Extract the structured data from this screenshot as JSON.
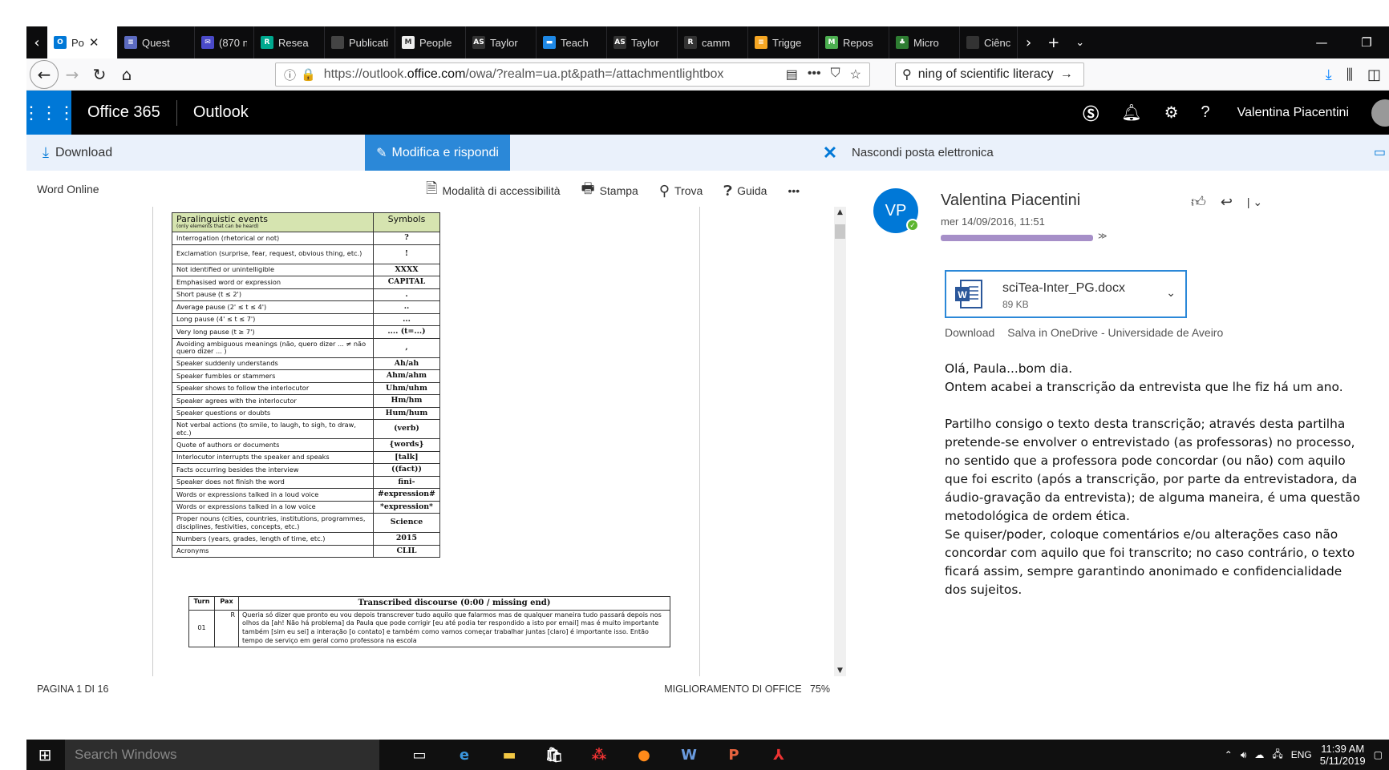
{
  "tabs": [
    {
      "label": "Po",
      "icon": "outlook-icon",
      "color": "#0078d7",
      "fav": "O"
    },
    {
      "label": "Quest",
      "icon": "forms-icon",
      "color": "#5c6bc0",
      "fav": "≡"
    },
    {
      "label": "(870 n",
      "icon": "mail-icon",
      "color": "#4a4ac8",
      "fav": "✉"
    },
    {
      "label": "Resea",
      "icon": "researchgate-icon",
      "color": "#00a98f",
      "fav": "R"
    },
    {
      "label": "Publicatio",
      "icon": "publications-icon",
      "color": "#444",
      "fav": ""
    },
    {
      "label": "People",
      "icon": "people-icon",
      "color": "#eeeeee",
      "fav": "M"
    },
    {
      "label": "Taylor",
      "icon": "taylor-icon",
      "color": "#333",
      "fav": "AS"
    },
    {
      "label": "Teach",
      "icon": "teach-icon",
      "color": "#1e88e5",
      "fav": "▬"
    },
    {
      "label": "Taylor",
      "icon": "taylor-icon",
      "color": "#333",
      "fav": "AS"
    },
    {
      "label": "camm",
      "icon": "r-icon",
      "color": "#333",
      "fav": "R"
    },
    {
      "label": "Trigge",
      "icon": "trigger-icon",
      "color": "#f5a623",
      "fav": "≡"
    },
    {
      "label": "Repos",
      "icon": "repos-icon",
      "color": "#4caf50",
      "fav": "M"
    },
    {
      "label": "Micro",
      "icon": "micro-icon",
      "color": "#2e7d32",
      "fav": "♣"
    },
    {
      "label": "Ciênc",
      "icon": "ciencia-icon",
      "color": "#333",
      "fav": ""
    }
  ],
  "url": {
    "prefix": "https://outlook.",
    "domain": "office.com",
    "path": "/owa/?realm=ua.pt&path=/attachmentlightbox"
  },
  "search": {
    "value": "ning of scientific literacy"
  },
  "office": {
    "brand": "Office 365",
    "app": "Outlook",
    "user": "Valentina Piacentini"
  },
  "toolbar": {
    "download": "Download",
    "edit": "Modifica e rispondi",
    "hide_mail": "Nascondi posta elettronica"
  },
  "wordbar": {
    "title": "Word Online",
    "accessibility": "Modalità di accessibilità",
    "print": "Stampa",
    "find": "Trova",
    "help": "Guida",
    "more": "•••"
  },
  "doc": {
    "para_header": "Paralinguistic events",
    "para_sub": "(only elements that can be heard)",
    "symbols_header": "Symbols",
    "rows": [
      [
        "Interrogation (rhetorical or not)",
        "?"
      ],
      [
        "Exclamation (surprise, fear, request, obvious thing, etc.)",
        "!"
      ],
      [
        "Not identified or unintelligible",
        "XXXX"
      ],
      [
        "Emphasised word or expression",
        "CAPITAL"
      ],
      [
        "Short pause (t ≤ 2')",
        "."
      ],
      [
        "Average pause (2' ≤ t ≤ 4')",
        ".."
      ],
      [
        "Long pause (4' ≤ t ≤ 7')",
        "..."
      ],
      [
        "Very long pause (t ≥ 7')",
        ".... (t=...)"
      ],
      [
        "Avoiding ambiguous meanings (não, quero dizer ... ≠ não quero dizer ... )",
        ","
      ],
      [
        "Speaker suddenly understands",
        "Ah/ah"
      ],
      [
        "Speaker fumbles or stammers",
        "Ahm/ahm"
      ],
      [
        "Speaker shows to follow the interlocutor",
        "Uhm/uhm"
      ],
      [
        "Speaker agrees with the interlocutor",
        "Hm/hm"
      ],
      [
        "Speaker questions or doubts",
        "Hum/hum"
      ],
      [
        "Not verbal actions (to smile, to laugh, to sigh, to draw, etc.)",
        "(verb)"
      ],
      [
        "Quote of authors or documents",
        "{words}"
      ],
      [
        "Interlocutor interrupts the speaker and speaks",
        "[talk]"
      ],
      [
        "Facts occurring besides the interview",
        "((fact))"
      ],
      [
        "Speaker does not finish the word",
        "fini-"
      ],
      [
        "Words or expressions talked in a loud voice",
        "#expression#"
      ],
      [
        "Words or expressions talked in a low voice",
        "*expression*"
      ],
      [
        "Proper nouns (cities, countries, institutions, programmes, disciplines, festivities, concepts, etc.)",
        "Science"
      ],
      [
        "Numbers (years, grades, length of time, etc.)",
        "2015"
      ],
      [
        "Acronyms",
        "CLIL"
      ]
    ],
    "disc_turn": "Turn",
    "disc_pax": "Pax",
    "disc_title": "Transcribed discourse (0:00 / missing end)",
    "disc_no": "01",
    "disc_speaker": "R",
    "disc_text": "Queria só dizer que pronto eu vou depois transcrever tudo aquilo que falarmos mas de qualquer maneira tudo passará depois nos olhos da [ah! Não há problema] da Paula que pode corrigir [eu até podia ter respondido a isto por email] mas é muito importante também [sim eu sei] a interação [o contato] e também como vamos começar trabalhar juntas [claro] é importante isso. Então tempo de serviço em geral como professora na escola"
  },
  "status": {
    "page": "PAGINA 1 DI 16",
    "improve": "MIGLIORAMENTO DI OFFICE",
    "zoom": "75%"
  },
  "mail": {
    "initials": "VP",
    "sender": "Valentina Piacentini",
    "date": "mer 14/09/2016, 11:51",
    "attach_name": "sciTea-Inter_PG.docx",
    "attach_size": "89 KB",
    "link_download": "Download",
    "link_onedrive": "Salva in OneDrive - Universidade de Aveiro",
    "greeting": "Olá, Paula...bom dia.",
    "p1": "Ontem acabei a transcrição da entrevista que lhe fiz há um ano.",
    "p2a": "Partilho consigo o texto desta transcrição; através desta partilha pretende-se envolver o entrevistado (as professoras) no processo, no sentido que a professora pode concordar (ou não) com aquilo que foi escrito (após a transcrição, por parte da entrevistadora, da áudio-gravação da entrevista); de alguma maneira, é uma questão metodológica de ordem ética.",
    "p2b": "Se quiser/poder, coloque comentários e/ou alterações caso não concordar com aquilo que foi transcrito; no caso contrário, o texto ficará assim, sempre garantindo anonimado e confidencialidade dos sujeitos."
  },
  "taskbar": {
    "search": "Search Windows",
    "lang": "ENG",
    "time": "11:39 AM",
    "date": "5/11/2019"
  },
  "colors": {
    "accent": "#0078d7",
    "edit_button": "#2b88d8",
    "header_bg": "#000000",
    "toolbar_bg": "#eaf1fb",
    "table_header": "#d6e4b0"
  }
}
